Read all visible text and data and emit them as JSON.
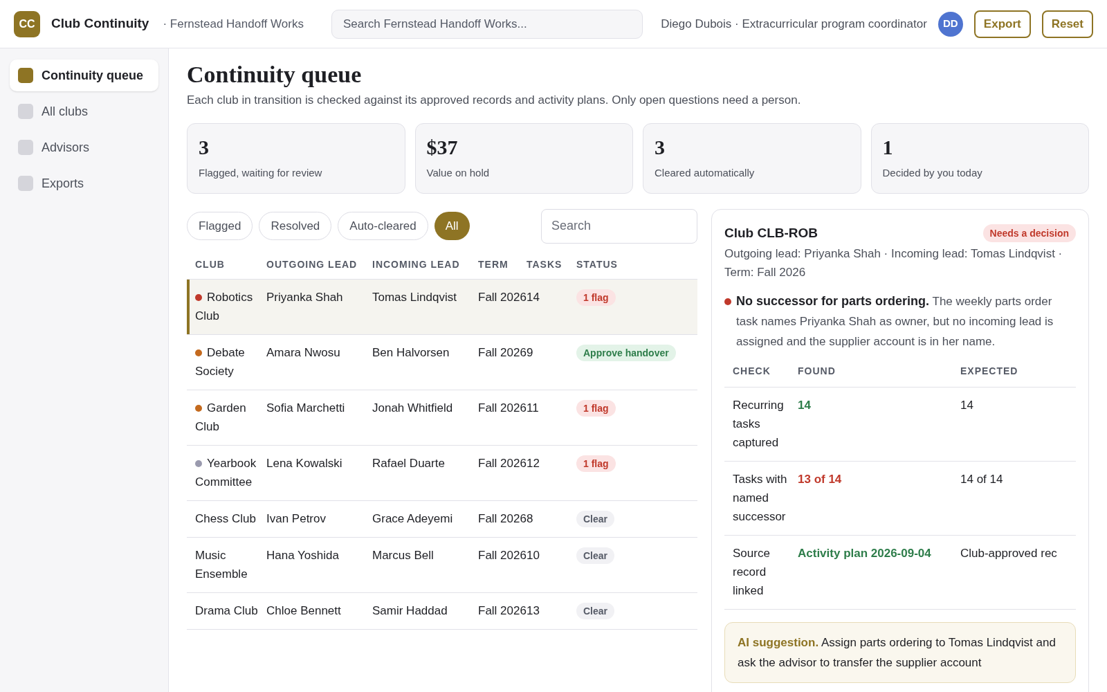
{
  "app": {
    "logo": "CC",
    "name": "Club Continuity",
    "workspace": "· Fernstead Handoff Works"
  },
  "search": {
    "placeholder": "Search Fernstead Handoff Works..."
  },
  "user": {
    "label": "Diego Dubois · Extracurricular program coordinator",
    "initials": "DD"
  },
  "header_buttons": [
    "Export",
    "Reset"
  ],
  "sidebar": {
    "items": [
      {
        "label": "Continuity queue",
        "selected": true
      },
      {
        "label": "All clubs",
        "selected": false
      },
      {
        "label": "Advisors",
        "selected": false
      },
      {
        "label": "Exports",
        "selected": false
      }
    ]
  },
  "page": {
    "title": "Continuity queue",
    "subtitle": "Each club in transition is checked against its approved records and activity plans. Only open questions need a person."
  },
  "stats": [
    {
      "value": "3",
      "label": "Flagged, waiting for review"
    },
    {
      "value": "$37",
      "label": "Value on hold"
    },
    {
      "value": "3",
      "label": "Cleared automatically"
    },
    {
      "value": "1",
      "label": "Decided by you today"
    }
  ],
  "filters": [
    {
      "label": "Flagged",
      "selected": false
    },
    {
      "label": "Resolved",
      "selected": false
    },
    {
      "label": "Auto-cleared",
      "selected": false
    },
    {
      "label": "All",
      "selected": true
    }
  ],
  "table_search": {
    "placeholder": "Search"
  },
  "table": {
    "columns": [
      "CLUB",
      "OUTGOING LEAD",
      "INCOMING LEAD",
      "TERM",
      "TASKS",
      "STATUS"
    ],
    "rows": [
      {
        "club": "Robotics Club",
        "color": "#c0392b",
        "outgoing": "Priyanka Shah",
        "incoming": "Tomas Lindqvist",
        "term": "Fall 2026",
        "tasks": "14",
        "status": "1 flag",
        "kind": "flag",
        "selected": true
      },
      {
        "club": "Debate Society",
        "color": "#c46a1e",
        "outgoing": "Amara Nwosu",
        "incoming": "Ben Halvorsen",
        "term": "Fall 2026",
        "tasks": "9",
        "status": "Approve handover",
        "kind": "approve",
        "selected": false
      },
      {
        "club": "Garden Club",
        "color": "#c46a1e",
        "outgoing": "Sofia Marchetti",
        "incoming": "Jonah Whitfield",
        "term": "Fall 2026",
        "tasks": "11",
        "status": "1 flag",
        "kind": "flag",
        "selected": false
      },
      {
        "club": "Yearbook Committee",
        "color": "#9a9aae",
        "outgoing": "Lena Kowalski",
        "incoming": "Rafael Duarte",
        "term": "Fall 2026",
        "tasks": "12",
        "status": "1 flag",
        "kind": "flag",
        "selected": false
      },
      {
        "club": "Chess Club",
        "outgoing": "Ivan Petrov",
        "incoming": "Grace Adeyemi",
        "term": "Fall 2026",
        "tasks": "8",
        "status": "Clear",
        "kind": "clear",
        "selected": false
      },
      {
        "club": "Music Ensemble",
        "outgoing": "Hana Yoshida",
        "incoming": "Marcus Bell",
        "term": "Fall 2026",
        "tasks": "10",
        "status": "Clear",
        "kind": "clear",
        "selected": false
      },
      {
        "club": "Drama Club",
        "outgoing": "Chloe Bennett",
        "incoming": "Samir Haddad",
        "term": "Fall 2026",
        "tasks": "13",
        "status": "Clear",
        "kind": "clear",
        "selected": false
      }
    ]
  },
  "detail": {
    "title": "Club CLB-ROB",
    "badge": "Needs a decision",
    "meta": "Outgoing lead: Priyanka Shah · Incoming lead: Tomas Lindqvist · Term: Fall 2026",
    "issue": {
      "color": "#c0392b",
      "text": "**No successor for parts ordering.** The weekly parts order task names Priyanka Shah as owner, but no incoming lead is assigned and the supplier account is in her name."
    },
    "checks": {
      "columns": [
        "CHECK",
        "FOUND",
        "EXPECTED"
      ],
      "rows": [
        {
          "check": "Recurring tasks captured",
          "found": "14",
          "kind": "ok",
          "expected": "14"
        },
        {
          "check": "Tasks with named successor",
          "found": "13 of 14",
          "kind": "bad",
          "expected": "14 of 14"
        },
        {
          "check": "Source record linked",
          "found": "Activity plan 2026-09-04",
          "kind": "ok",
          "expected": "Club-approved rec"
        }
      ]
    },
    "suggestion": "**AI suggestion.** Assign parts ordering to Tomas Lindqvist and ask the advisor to transfer the supplier account"
  }
}
